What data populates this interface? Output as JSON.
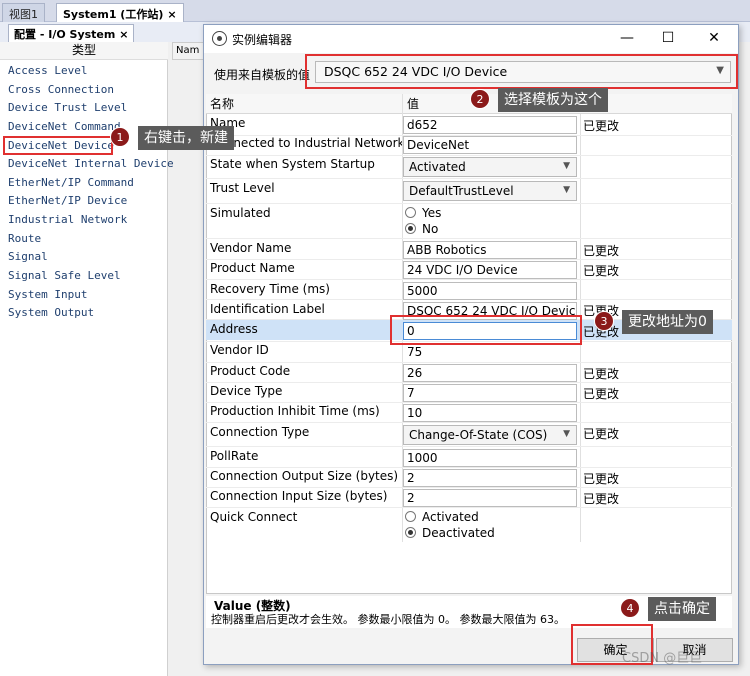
{
  "tabs": [
    {
      "label": "视图1"
    },
    {
      "label": "System1 (工作站)",
      "close": "×"
    }
  ],
  "subtab": {
    "label": "配置 - I/O System",
    "close": "×"
  },
  "left_header": "类型",
  "left_items": [
    "Access Level",
    "Cross Connection",
    "Device Trust Level",
    "DeviceNet Command",
    "DeviceNet Device",
    "DeviceNet Internal Device",
    "EtherNet/IP Command",
    "EtherNet/IP Device",
    "Industrial Network",
    "Route",
    "Signal",
    "Signal Safe Level",
    "System Input",
    "System Output"
  ],
  "name_column_label": "Nam",
  "dialog": {
    "title": "实例编辑器",
    "minimize": "—",
    "maximize": "☐",
    "close": "✕",
    "template_label": "使用来自模板的值",
    "template_value": "DSQC 652 24 VDC I/O Device",
    "grid_header_name": "名称",
    "grid_header_value": "值",
    "rows": [
      {
        "name": "Name",
        "value": "d652",
        "changed": "已更改"
      },
      {
        "name": "Connected to Industrial Network",
        "value": "DeviceNet",
        "changed": ""
      },
      {
        "name": "State when System Startup",
        "value": "Activated",
        "changed": ""
      },
      {
        "name": "Trust Level",
        "value": "DefaultTrustLevel",
        "changed": ""
      },
      {
        "name": "Simulated",
        "opt1": "Yes",
        "opt2": "No",
        "changed": ""
      },
      {
        "name": "Vendor Name",
        "value": "ABB Robotics",
        "changed": "已更改"
      },
      {
        "name": "Product Name",
        "value": "24 VDC I/O Device",
        "changed": "已更改"
      },
      {
        "name": "Recovery Time (ms)",
        "value": "5000",
        "changed": ""
      },
      {
        "name": "Identification Label",
        "value": "DSQC 652 24 VDC I/O Device",
        "changed": "已更改"
      },
      {
        "name": "Address",
        "value": "0",
        "changed": "已更改"
      },
      {
        "name": "Vendor ID",
        "value": "75",
        "changed": ""
      },
      {
        "name": "Product Code",
        "value": "26",
        "changed": "已更改"
      },
      {
        "name": "Device Type",
        "value": "7",
        "changed": "已更改"
      },
      {
        "name": "Production Inhibit Time (ms)",
        "value": "10",
        "changed": ""
      },
      {
        "name": "Connection Type",
        "value": "Change-Of-State (COS)",
        "changed": "已更改"
      },
      {
        "name": "PollRate",
        "value": "1000",
        "changed": ""
      },
      {
        "name": "Connection Output Size (bytes)",
        "value": "2",
        "changed": "已更改"
      },
      {
        "name": "Connection Input Size (bytes)",
        "value": "2",
        "changed": "已更改"
      },
      {
        "name": "Quick Connect",
        "opt1": "Activated",
        "opt2": "Deactivated",
        "changed": ""
      }
    ],
    "desc_title": "Value (整数)",
    "desc_text": "控制器重启后更改才会生效。 参数最小限值为 0。 参数最大限值为 63。",
    "ok_label": "确定",
    "cancel_label": "取消"
  },
  "annotations": {
    "n1": "1",
    "t1": "右键击，新建",
    "n2": "2",
    "t2": "选择模板为这个",
    "n3": "3",
    "t3": "更改地址为0",
    "n4": "4",
    "t4": "点击确定"
  },
  "watermark": "CSDN @巨巨",
  "colors": {
    "annotation_red": "#e03030",
    "badge": "#8b1a1a",
    "callout_bg": "#5b5b5b",
    "selected_row": "#cfe2f7"
  }
}
